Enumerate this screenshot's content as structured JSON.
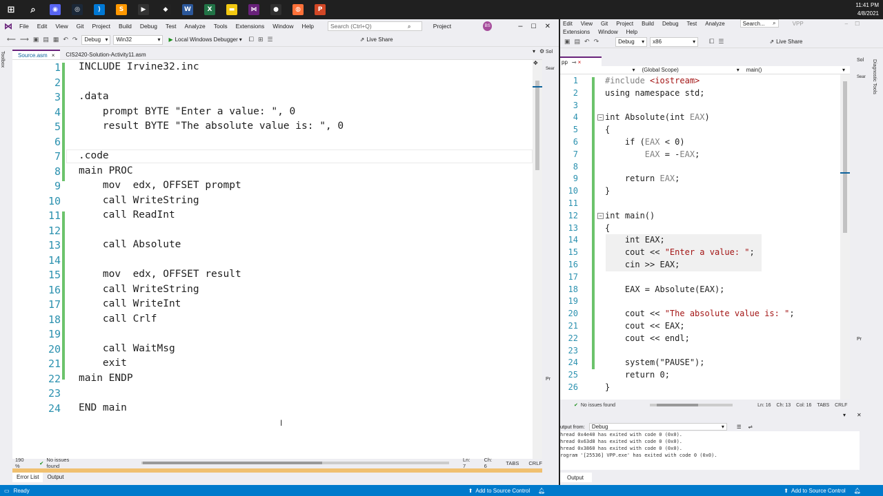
{
  "taskbar": {
    "icons": [
      "windows-start-icon",
      "search-icon",
      "discord-icon",
      "steam-icon",
      "vscode-icon",
      "sublime-icon",
      "terminal-icon",
      "unity-icon",
      "word-icon",
      "excel-icon",
      "file-explorer-icon",
      "visual-studio-icon",
      "obs-icon",
      "firefox-icon",
      "powerpoint-icon"
    ],
    "time": "11:41 PM",
    "date": "4/8/2021"
  },
  "left": {
    "menu": [
      "File",
      "Edit",
      "View",
      "Git",
      "Project",
      "Build",
      "Debug",
      "Test",
      "Analyze",
      "Tools",
      "Extensions",
      "Window",
      "Help"
    ],
    "search_placeholder": "Search (Ctrl+Q)",
    "project_label": "Project",
    "avatar": "BS",
    "config": "Debug",
    "platform": "Win32",
    "debugger": "Local Windows Debugger",
    "live_share": "Live Share",
    "tabs": [
      "Source.asm",
      "CIS2420-Solution-Activity11.asm"
    ],
    "toolbox_label": "Toolbox",
    "code": [
      "INCLUDE Irvine32.inc",
      "",
      ".data",
      "    prompt BYTE \"Enter a value: \", 0",
      "    result BYTE \"The absolute value is: \", 0",
      "",
      ".code",
      "main PROC",
      "    mov  edx, OFFSET prompt",
      "    call WriteString",
      "    call ReadInt",
      "",
      "    call Absolute",
      "",
      "    mov  edx, OFFSET result",
      "    call WriteString",
      "    call WriteInt",
      "    call Crlf",
      "",
      "    call WaitMsg",
      "    exit",
      "main ENDP",
      "",
      "END main"
    ],
    "line_numbers": [
      "1",
      "2",
      "3",
      "4",
      "5",
      "6",
      "7",
      "8",
      "9",
      "10",
      "11",
      "12",
      "13",
      "14",
      "15",
      "16",
      "17",
      "18",
      "19",
      "20",
      "21",
      "22",
      "23",
      "24"
    ],
    "zoom": "190 %",
    "issues": "No issues found",
    "ln": "Ln: 7",
    "ch": "Ch: 6",
    "tabs_mode": "TABS",
    "eol": "CRLF",
    "bottom_tabs": [
      "Error List",
      "Output"
    ],
    "side_labels": [
      "Sol",
      "Sear",
      "Pr"
    ]
  },
  "right": {
    "menu_row1": [
      "Edit",
      "View",
      "Git",
      "Project",
      "Build",
      "Debug",
      "Test",
      "Analyze"
    ],
    "menu_row2": [
      "Extensions",
      "Window",
      "Help"
    ],
    "search_placeholder": "Search...",
    "title": "VPP",
    "config": "Debug",
    "platform": "x86",
    "live_share": "Live Share",
    "tab": "pp",
    "scope": "(Global Scope)",
    "function": "main()",
    "code": [
      [
        {
          "t": "#include ",
          "c": "var"
        },
        {
          "t": "<iostream>",
          "c": "str"
        }
      ],
      [
        {
          "t": "using namespace std;",
          "c": ""
        }
      ],
      [],
      [
        {
          "t": "int Absolute(int ",
          "c": ""
        },
        {
          "t": "EAX",
          "c": "var"
        },
        {
          "t": ")",
          "c": ""
        }
      ],
      [
        {
          "t": "{",
          "c": ""
        }
      ],
      [
        {
          "t": "    if (",
          "c": ""
        },
        {
          "t": "EAX",
          "c": "var"
        },
        {
          "t": " < 0)",
          "c": ""
        }
      ],
      [
        {
          "t": "        ",
          "c": ""
        },
        {
          "t": "EAX",
          "c": "var"
        },
        {
          "t": " = -",
          "c": ""
        },
        {
          "t": "EAX",
          "c": "var"
        },
        {
          "t": ";",
          "c": ""
        }
      ],
      [],
      [
        {
          "t": "    return ",
          "c": ""
        },
        {
          "t": "EAX",
          "c": "var"
        },
        {
          "t": ";",
          "c": ""
        }
      ],
      [
        {
          "t": "}",
          "c": ""
        }
      ],
      [],
      [
        {
          "t": "int main()",
          "c": ""
        }
      ],
      [
        {
          "t": "{",
          "c": ""
        }
      ],
      [
        {
          "t": "    int EAX;",
          "c": ""
        }
      ],
      [
        {
          "t": "    cout << ",
          "c": ""
        },
        {
          "t": "\"Enter a value: \"",
          "c": "str"
        },
        {
          "t": ";",
          "c": ""
        }
      ],
      [
        {
          "t": "    cin >> EAX;",
          "c": ""
        }
      ],
      [],
      [
        {
          "t": "    EAX = Absolute(EAX);",
          "c": ""
        }
      ],
      [],
      [
        {
          "t": "    cout << ",
          "c": ""
        },
        {
          "t": "\"The absolute value is: \"",
          "c": "str"
        },
        {
          "t": ";",
          "c": ""
        }
      ],
      [
        {
          "t": "    cout << EAX;",
          "c": ""
        }
      ],
      [
        {
          "t": "    cout << endl;",
          "c": ""
        }
      ],
      [],
      [
        {
          "t": "    system(\"PAUSE\");",
          "c": ""
        }
      ],
      [
        {
          "t": "    return 0;",
          "c": ""
        }
      ],
      [
        {
          "t": "}",
          "c": ""
        }
      ]
    ],
    "line_numbers": [
      "1",
      "2",
      "3",
      "4",
      "5",
      "6",
      "7",
      "8",
      "9",
      "10",
      "11",
      "12",
      "13",
      "14",
      "15",
      "16",
      "17",
      "18",
      "19",
      "20",
      "21",
      "22",
      "23",
      "24",
      "25",
      "26"
    ],
    "issues": "No issues found",
    "ln": "Ln: 16",
    "ch": "Ch: 13",
    "col": "Col: 16",
    "tabs_mode": "TABS",
    "eol": "CRLF",
    "output_from_label": "utput from:",
    "output_source": "Debug",
    "output_lines": [
      "hread 0x4e40 has exited with code 0 (0x0).",
      "hread 0x63d8 has exited with code 0 (0x0).",
      "hread 0x3860 has exited with code 0 (0x0).",
      "rogram '[25536] VPP.exe' has exited with code 0 (0x0)."
    ],
    "output_tab": "Output",
    "side_labels": [
      "Sol",
      "Sear",
      "Pr",
      "Pr"
    ],
    "diag_label": "Diagnostic Tools"
  },
  "status": {
    "ready": "Ready",
    "add_source_left": "Add to Source Control",
    "add_source_right": "Add to Source Control",
    "accent": "#007acc"
  }
}
